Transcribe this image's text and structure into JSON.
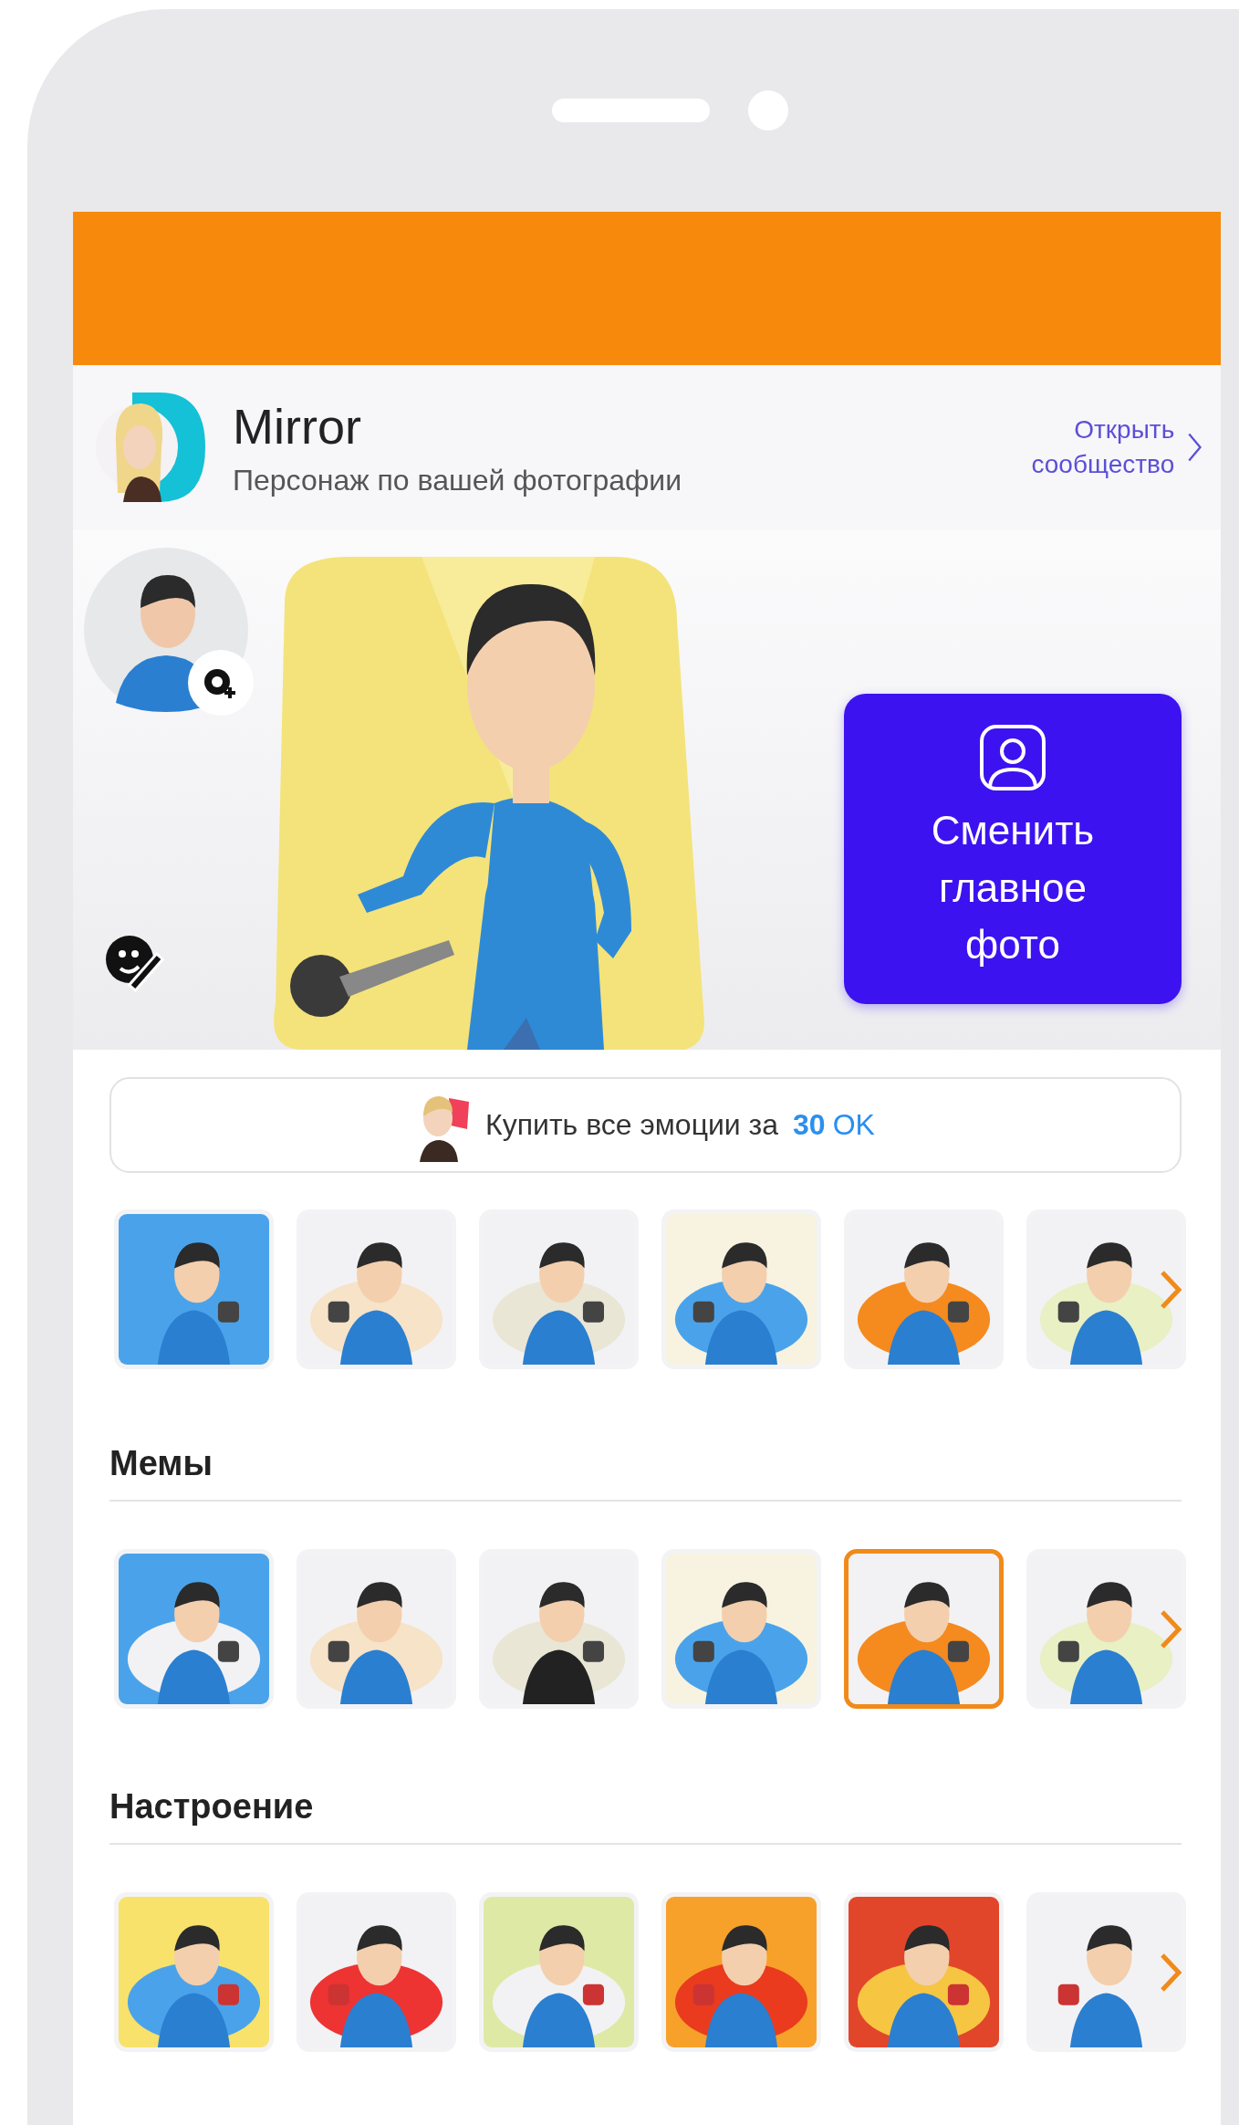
{
  "header": {
    "title": "Mirror",
    "subtitle": "Персонаж по вашей фотографии",
    "link": "Открыть сообщество"
  },
  "hero": {
    "button": "Сменить главное фото"
  },
  "buy": {
    "label": "Купить все эмоции за",
    "price": "30",
    "currency": "OK"
  },
  "sections": [
    {
      "stickers": [
        {
          "selected": false
        },
        {
          "selected": false
        },
        {
          "selected": false
        },
        {
          "selected": false
        },
        {
          "selected": false
        },
        {
          "selected": false
        }
      ]
    },
    {
      "title": "Мемы",
      "stickers": [
        {
          "selected": false
        },
        {
          "selected": false
        },
        {
          "selected": false
        },
        {
          "selected": false
        },
        {
          "selected": true
        },
        {
          "selected": false
        }
      ]
    },
    {
      "title": "Настроение",
      "stickers": [
        {
          "selected": false
        },
        {
          "selected": false
        },
        {
          "selected": false
        },
        {
          "selected": false
        },
        {
          "selected": false
        },
        {
          "selected": false
        }
      ]
    }
  ]
}
